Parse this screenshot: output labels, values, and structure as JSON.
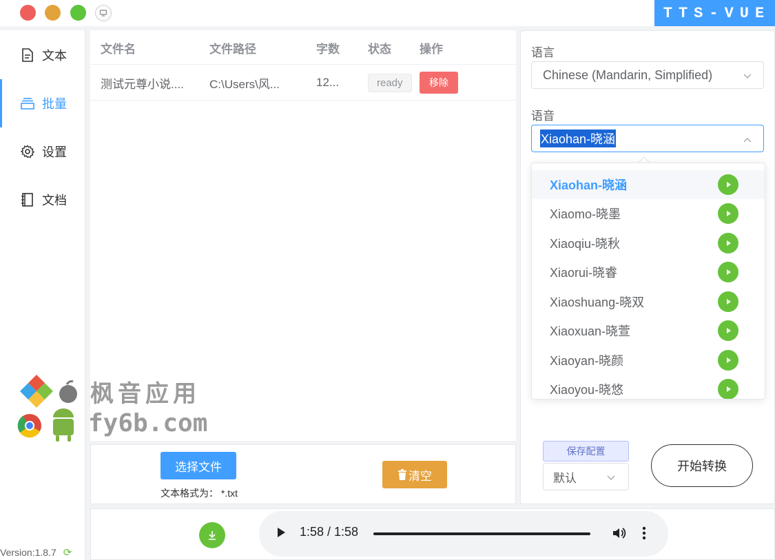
{
  "window": {
    "brand": "TTS-VUE"
  },
  "sidebar": {
    "items": [
      {
        "label": "文本",
        "icon": "document-icon",
        "active": false
      },
      {
        "label": "批量",
        "icon": "layers-icon",
        "active": true
      },
      {
        "label": "设置",
        "icon": "gear-icon",
        "active": false
      },
      {
        "label": "文档",
        "icon": "notebook-icon",
        "active": false
      }
    ],
    "version": "Version:1.8.7"
  },
  "file_table": {
    "columns": [
      "文件名",
      "文件路径",
      "字数",
      "状态",
      "操作"
    ],
    "rows": [
      {
        "name": "测试元尊小说....",
        "path": "C:\\Users\\风...",
        "count": "12...",
        "status": "ready",
        "action": "移除"
      }
    ]
  },
  "watermark": {
    "line1": "枫音应用",
    "line2": "fy6b.com"
  },
  "batch_actions": {
    "select_label": "选择文件",
    "format_label": "文本格式为：  *.txt",
    "clear_label": "清空"
  },
  "settings": {
    "language_label": "语言",
    "language_value": "Chinese (Mandarin, Simplified)",
    "voice_label": "语音",
    "voice_value": "Xiaohan-晓涵",
    "voice_options": [
      "Xiaohan-晓涵",
      "Xiaomo-晓墨",
      "Xiaoqiu-晓秋",
      "Xiaorui-晓睿",
      "Xiaoshuang-晓双",
      "Xiaoxuan-晓萱",
      "Xiaoyan-晓颜",
      "Xiaoyou-晓悠"
    ],
    "save_config_label": "保存配置",
    "preset_value": "默认",
    "start_label": "开始转换"
  },
  "player": {
    "time": "1:58 / 1:58",
    "progress": 1.0
  },
  "colors": {
    "primary": "#409eff",
    "success": "#67c23a",
    "warning": "#e6a23c",
    "danger": "#f56c6c"
  }
}
